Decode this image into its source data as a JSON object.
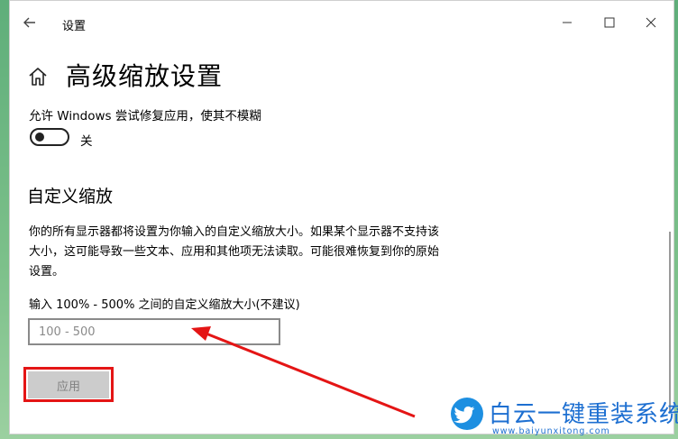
{
  "window": {
    "title": "设置",
    "controls": [
      "minimize-icon",
      "maximize-icon",
      "close-icon"
    ]
  },
  "page": {
    "title": "高级缩放设置",
    "home_icon": "home-icon"
  },
  "blur_fix": {
    "label": "允许 Windows 尝试修复应用，使其不模糊",
    "state_text": "关",
    "on": false
  },
  "custom_scaling": {
    "heading": "自定义缩放",
    "description": "你的所有显示器都将设置为你输入的自定义缩放大小。如果某个显示器不支持该大小，这可能导致一些文本、应用和其他项无法读取。可能很难恢复到你的原始设置。",
    "input_label": "输入 100% - 500% 之间的自定义缩放大小(不建议)",
    "input_value": "",
    "input_placeholder": "100 - 500",
    "apply_label": "应用",
    "apply_enabled": false
  },
  "annotation": {
    "color": "#e41515"
  },
  "watermark": {
    "title": "白云一键重装系统",
    "url": "www.baiyunxitong.com",
    "color": "#1d6fd1",
    "icon": "twitter-bird-icon"
  }
}
